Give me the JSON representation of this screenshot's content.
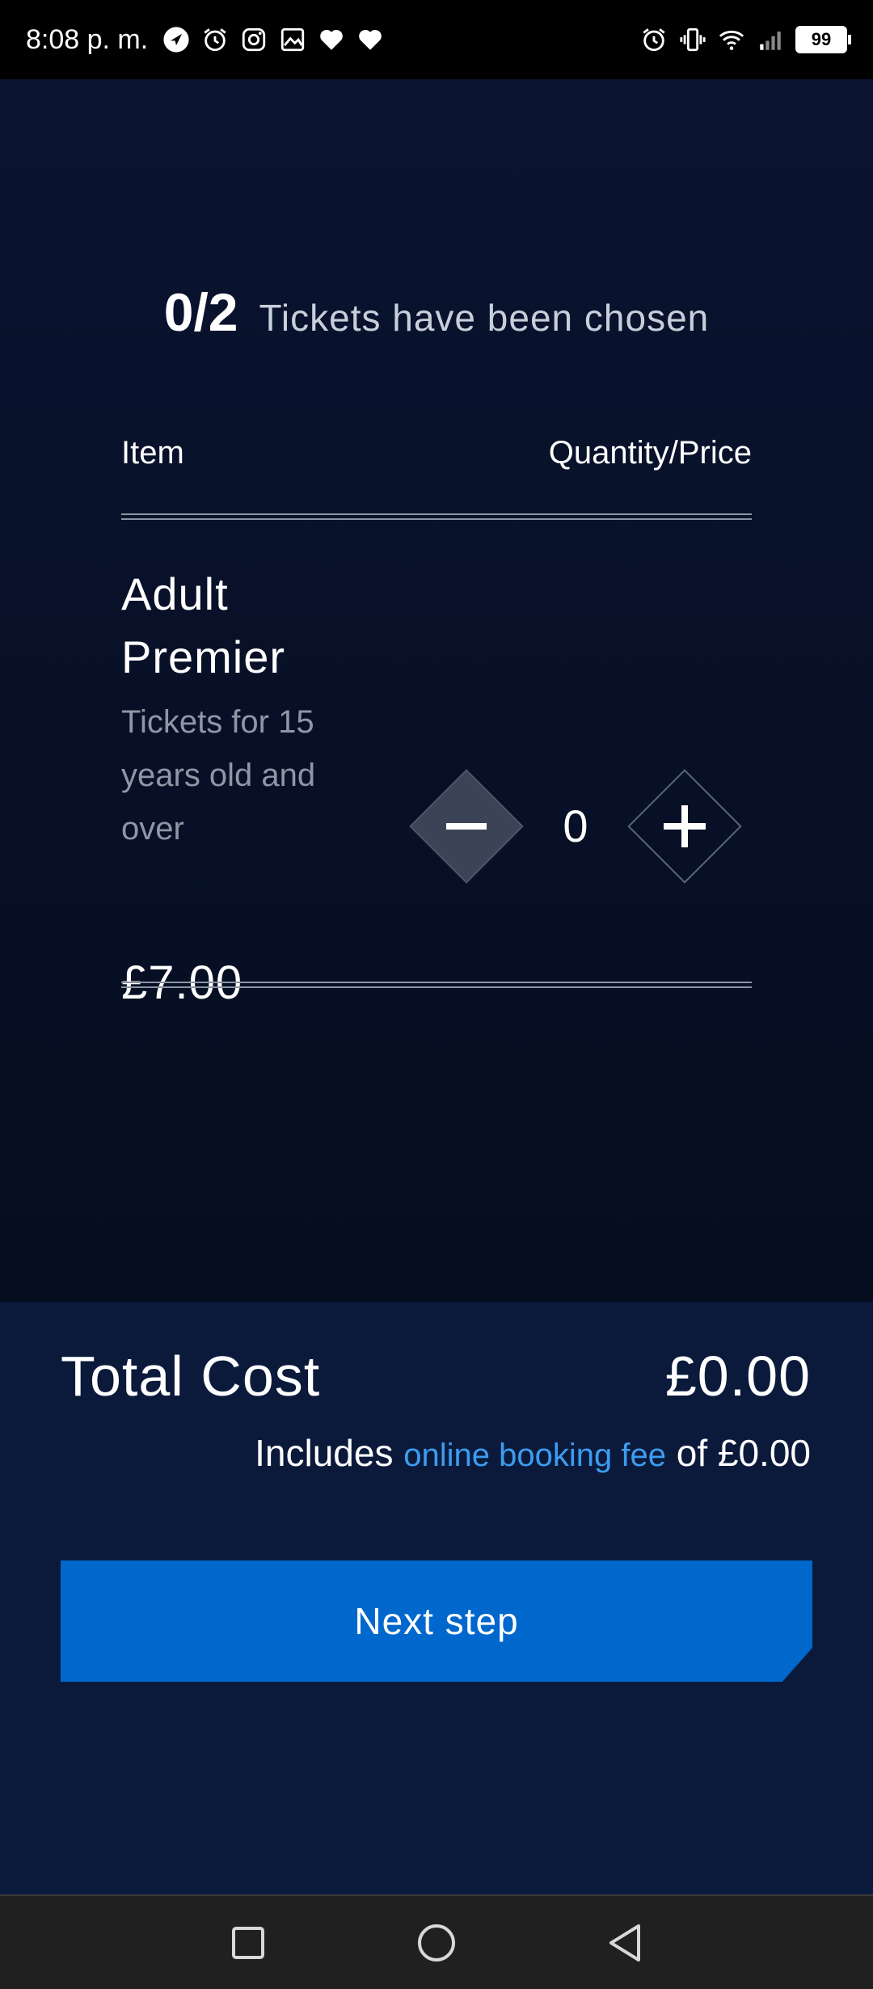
{
  "status_bar": {
    "time": "8:08 p. m.",
    "battery": "99",
    "left_icons": [
      "navigation-icon",
      "alarm-icon",
      "instagram-icon",
      "gallery-icon",
      "heart-icon",
      "heart-icon"
    ],
    "right_icons": [
      "alarm-icon",
      "vibrate-icon",
      "wifi-icon",
      "signal-icon",
      "battery-icon"
    ]
  },
  "header": {
    "chosen_count": "0/2",
    "chosen_label": "Tickets have been chosen"
  },
  "table": {
    "col_item": "Item",
    "col_quantity_price": "Quantity/Price"
  },
  "ticket": {
    "name": "Adult Premier",
    "description": "Tickets for 15 years old and over",
    "price": "£7.00",
    "quantity": "0"
  },
  "summary": {
    "total_label": "Total Cost",
    "total_value": "£0.00",
    "fee_prefix": "Includes",
    "fee_link": "online booking fee",
    "fee_suffix": "of £0.00",
    "next_button": "Next step"
  },
  "colors": {
    "background": "#081126",
    "summary_background": "#0b1a3b",
    "accent": "#0067cc",
    "link": "#3c9cf0"
  }
}
